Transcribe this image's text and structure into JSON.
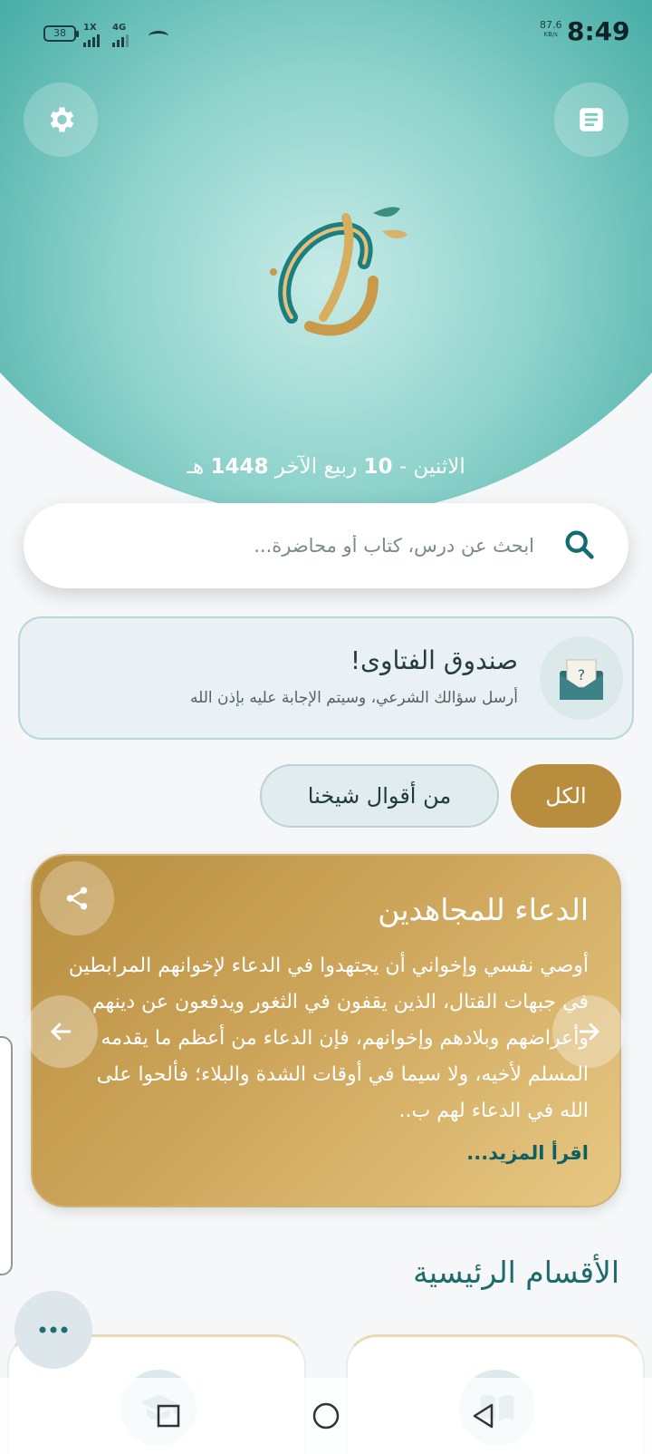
{
  "status_bar": {
    "battery": "38",
    "sim1": "1X",
    "sim2": "4G",
    "speed_value": "87.6",
    "speed_unit": "KB/s",
    "time": "8:49"
  },
  "header": {
    "settings_icon": "gear-icon",
    "menu_icon": "document-list-icon",
    "logo_text": "الخليل",
    "date": {
      "day": "الاثنين -",
      "day_num": "10",
      "month": "ربيع الآخر",
      "year": "1448",
      "era": "هـ"
    }
  },
  "search": {
    "placeholder": "ابحث عن درس، كتاب أو محاضرة..."
  },
  "fatwa_box": {
    "title": "صندوق الفتاوى!",
    "subtitle": "أرسل سؤالك الشرعي، وسيتم الإجابة عليه بإذن الله"
  },
  "filters": {
    "all": "الكل",
    "sayings": "من أقوال شيخنا"
  },
  "quote_card": {
    "title": "الدعاء للمجاهدين",
    "body": "أوصي نفسي وإخواني أن يجتهدوا في الدعاء لإخوانهم المرابطين في جبهات القتال، الذين يقفون في الثغور ويدفعون عن دينهم وأعراضهم وبلادهم وإخوانهم، فإن الدعاء من أعظم ما يقدمه المسلم لأخيه، ولا سيما في أوقات الشدة والبلاء؛ فألحوا على الله في الدعاء لهم ب..",
    "read_more": "اقرأ المزيد..."
  },
  "sections": {
    "title": "الأقسام الرئيسية"
  },
  "colors": {
    "teal_dark": "#0f6f72",
    "teal_light": "#8fd3cc",
    "gold": "#b88e3e",
    "text_teal": "#1e6b6e"
  }
}
